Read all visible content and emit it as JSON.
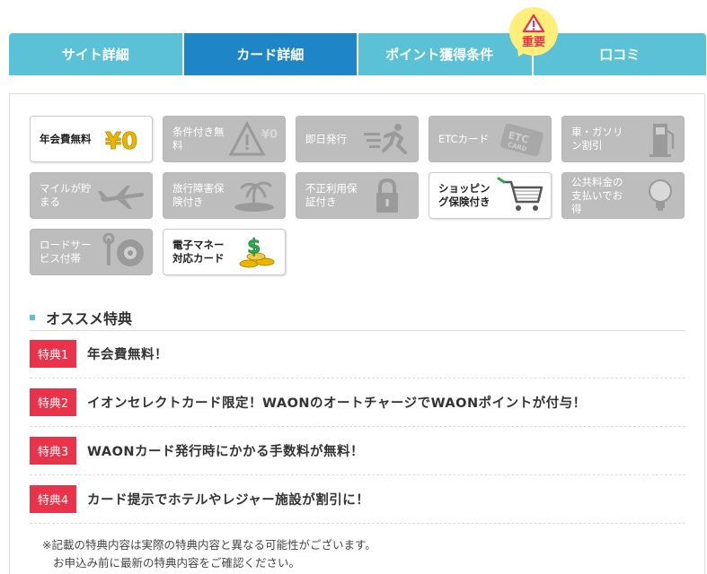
{
  "tabs": [
    {
      "label": "サイト詳細",
      "active": false
    },
    {
      "label": "カード詳細",
      "active": true
    },
    {
      "label": "ポイント獲得条件",
      "active": false
    },
    {
      "label": "口コミ",
      "active": false
    }
  ],
  "badge": {
    "label": "重要"
  },
  "features": [
    {
      "label": "年会費無料",
      "icon": "yen-zero-icon",
      "on": true
    },
    {
      "label": "条件付き無料",
      "icon": "warning-icon",
      "on": false
    },
    {
      "label": "即日発行",
      "icon": "running-person-icon",
      "on": false
    },
    {
      "label": "ETCカード",
      "icon": "etc-card-icon",
      "on": false
    },
    {
      "label": "車・ガソリン割引",
      "icon": "gas-pump-icon",
      "on": false
    },
    {
      "label": "マイルが貯まる",
      "icon": "airplane-icon",
      "on": false
    },
    {
      "label": "旅行障害保険付き",
      "icon": "palm-island-icon",
      "on": false
    },
    {
      "label": "不正利用保証付き",
      "icon": "padlock-icon",
      "on": false
    },
    {
      "label": "ショッピング保険付き",
      "icon": "shopping-cart-icon",
      "on": true
    },
    {
      "label": "公共料金の支払いでお得",
      "icon": "lightbulb-icon",
      "on": false
    },
    {
      "label": "ロードサービス付帯",
      "icon": "wrench-tire-icon",
      "on": false
    },
    {
      "label": "電子マネー対応カード",
      "icon": "money-coins-icon",
      "on": true
    }
  ],
  "section": {
    "title": "オススメ特典"
  },
  "benefits": [
    {
      "tag": "特典1",
      "text": "年会費無料！"
    },
    {
      "tag": "特典2",
      "text": "イオンセレクトカード限定！WAONのオートチャージでWAONポイントが付与！"
    },
    {
      "tag": "特典3",
      "text": "WAONカード発行時にかかる手数料が無料！"
    },
    {
      "tag": "特典4",
      "text": "カード提示でホテルやレジャー施設が割引に！"
    }
  ],
  "note": {
    "line1": "※記載の特典内容は実際の特典内容と異なる可能性がございます。",
    "line2": "お申込み前に最新の特典内容をご確認ください。"
  },
  "colors": {
    "tab": "#5bc1d6",
    "tab_active": "#1e86c6",
    "accent_red": "#e8334a",
    "badge": "#ffef7a"
  }
}
